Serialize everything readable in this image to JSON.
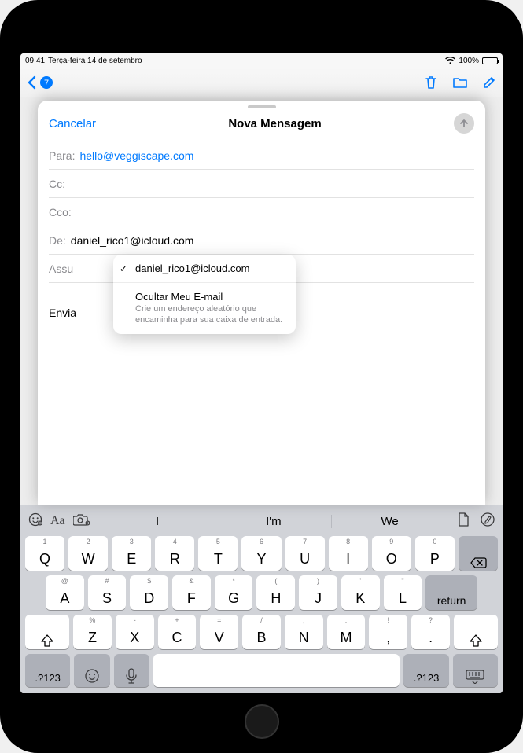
{
  "status": {
    "time": "09:41",
    "date": "Terça-feira 14 de setembro",
    "battery_pct": "100%"
  },
  "compose": {
    "cancel": "Cancelar",
    "title": "Nova Mensagem",
    "to_label": "Para:",
    "to_value": "hello@veggiscape.com",
    "cc_label": "Cc:",
    "bcc_label": "Cco:",
    "from_label": "De:",
    "from_value": "daniel_rico1@icloud.com",
    "subject_label": "Assu",
    "body_preview": "Envia"
  },
  "from_popover": {
    "selected_email": "daniel_rico1@icloud.com",
    "hide_title": "Ocultar Meu E-mail",
    "hide_sub": "Crie um endereço aleatório que encaminha para sua caixa de entrada."
  },
  "keyboard": {
    "suggestions": [
      "I",
      "I'm",
      "We"
    ],
    "row1_main": [
      "Q",
      "W",
      "E",
      "R",
      "T",
      "Y",
      "U",
      "I",
      "O",
      "P"
    ],
    "row1_alt": [
      "1",
      "2",
      "3",
      "4",
      "5",
      "6",
      "7",
      "8",
      "9",
      "0"
    ],
    "row2_main": [
      "A",
      "S",
      "D",
      "F",
      "G",
      "H",
      "J",
      "K",
      "L"
    ],
    "row2_alt": [
      "@",
      "#",
      "$",
      "&",
      "*",
      "(",
      ")",
      "'",
      "\""
    ],
    "row3_main": [
      "Z",
      "X",
      "C",
      "V",
      "B",
      "N",
      "M",
      ",",
      "."
    ],
    "row3_alt": [
      "%",
      "-",
      "+",
      "=",
      "/",
      ";",
      ":",
      "!",
      "?"
    ],
    "return_label": "return",
    "sym_label": ".?123"
  }
}
